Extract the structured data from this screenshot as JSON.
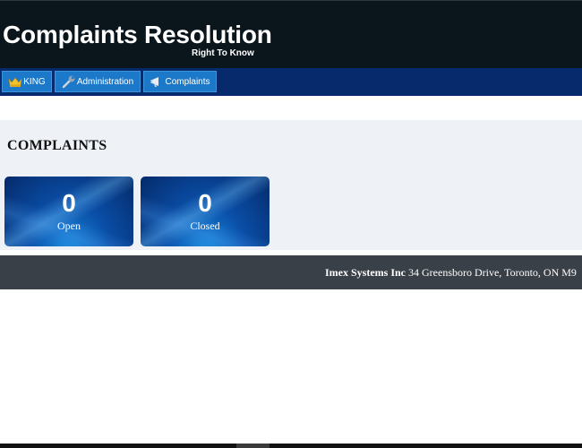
{
  "header": {
    "title": "Complaints Resolution",
    "subtitle": "Right To Know"
  },
  "nav": {
    "items": [
      {
        "label": "KING",
        "icon": "crown-icon"
      },
      {
        "label": "Administration",
        "icon": "wrench-icon"
      },
      {
        "label": "Complaints",
        "icon": "megaphone-icon"
      }
    ]
  },
  "complaints": {
    "heading": "COMPLAINTS",
    "tiles": [
      {
        "value": "0",
        "label": "Open"
      },
      {
        "value": "0",
        "label": "Closed"
      }
    ]
  },
  "footer": {
    "company": "Imex Systems Inc",
    "address": "34 Greensboro Drive, Toronto, ON M9"
  },
  "colors": {
    "header_bg": "#0b151c",
    "nav_bg": "#062a6c",
    "nav_button": "#1c79c9",
    "panel_bg": "#eef1f6",
    "tile_blue": "#0a4fa8",
    "footer_bg": "#3a4048"
  }
}
